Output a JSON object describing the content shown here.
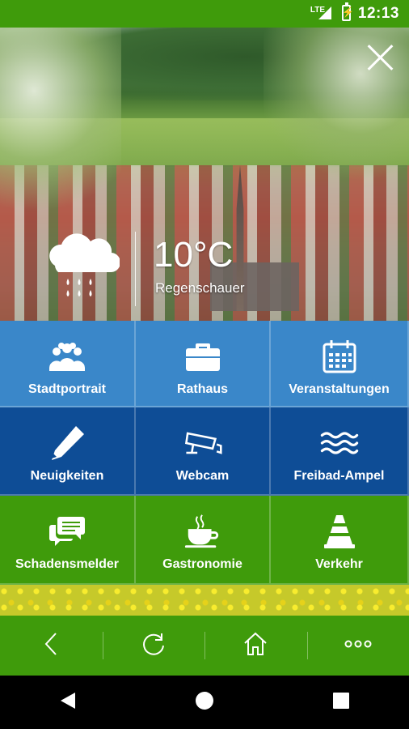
{
  "status_bar": {
    "network": "LTE",
    "time": "12:13"
  },
  "weather": {
    "temperature": "10°C",
    "description": "Regenschauer",
    "icon": "rain-cloud-icon"
  },
  "tiles": [
    {
      "label": "Stadtportrait",
      "icon": "people-group-icon"
    },
    {
      "label": "Rathaus",
      "icon": "briefcase-icon"
    },
    {
      "label": "Veranstaltungen",
      "icon": "calendar-icon"
    },
    {
      "label": "Neuigkeiten",
      "icon": "pencil-icon"
    },
    {
      "label": "Webcam",
      "icon": "security-camera-icon"
    },
    {
      "label": "Freibad-Ampel",
      "icon": "water-waves-icon"
    },
    {
      "label": "Schadensmelder",
      "icon": "chat-bubbles-icon"
    },
    {
      "label": "Gastronomie",
      "icon": "coffee-cup-icon"
    },
    {
      "label": "Verkehr",
      "icon": "traffic-cone-icon"
    }
  ],
  "toolbar": [
    "back-icon",
    "reload-icon",
    "home-icon",
    "more-icon"
  ],
  "nav": [
    "back-triangle-icon",
    "home-circle-icon",
    "recents-square-icon"
  ],
  "colors": {
    "green": "#3f9b0b",
    "light_blue": "#3a87c9",
    "dark_blue": "#0e4d96"
  }
}
